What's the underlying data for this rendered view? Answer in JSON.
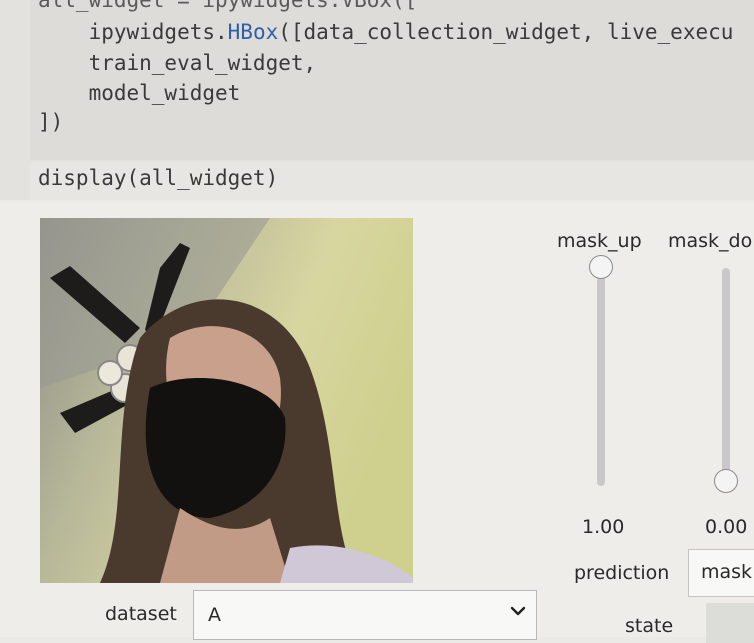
{
  "code": {
    "line0": "all_widget = ipywidgets.VBox([",
    "line1_prefix": "    ipywidgets.",
    "line1_kw": "HBox",
    "line1_suffix": "([data_collection_widget, live_execu",
    "line2": "    train_eval_widget,",
    "line3": "    model_widget",
    "line4": "])",
    "display": "display(all_widget)"
  },
  "sliders": [
    {
      "label": "mask_up",
      "value_text": "1.00",
      "value": 1.0
    },
    {
      "label": "mask_do",
      "value_text": "0.00",
      "value": 0.0
    }
  ],
  "prediction": {
    "label": "prediction",
    "value": "mask"
  },
  "state": {
    "label": "state"
  },
  "dataset": {
    "label": "dataset",
    "selected": "A"
  },
  "colors": {
    "code_keyword": "#2f5fa8",
    "slider_track": "#c8c8c8"
  }
}
